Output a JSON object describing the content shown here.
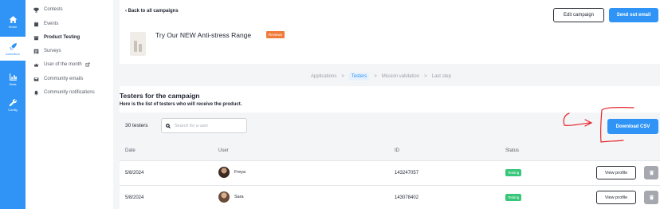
{
  "rail": {
    "items": [
      {
        "label": "Home",
        "icon": "home-icon"
      },
      {
        "label": "Animation",
        "icon": "rocket-icon"
      },
      {
        "label": "Stats",
        "icon": "chart-icon"
      },
      {
        "label": "Config",
        "icon": "wrench-icon"
      }
    ]
  },
  "submenu": {
    "items": [
      {
        "label": "Contests",
        "icon": "trophy-icon"
      },
      {
        "label": "Events",
        "icon": "calendar-icon"
      },
      {
        "label": "Product Testing",
        "icon": "box-icon"
      },
      {
        "label": "Surveys",
        "icon": "survey-icon"
      },
      {
        "label": "User of the month",
        "icon": "crown-icon"
      },
      {
        "label": "Community emails",
        "icon": "mail-icon"
      },
      {
        "label": "Community notifications",
        "icon": "bell-icon"
      }
    ]
  },
  "header": {
    "back_label": "‹ Back to all campaigns",
    "edit_label": "Edit campaign",
    "send_label": "Send out email",
    "campaign_title": "Try Our NEW Anti-stress Range",
    "campaign_badge": "Reviews"
  },
  "steps": {
    "items": [
      "Applications",
      "Testers",
      "Mission validation",
      "Last step"
    ],
    "separator": ">"
  },
  "testers": {
    "title": "Testers for the campaign",
    "subtitle": "Here is the list of testers who will receive the product.",
    "count_label": "30 testers",
    "search_placeholder": "Search for a user",
    "download_label": "Download CSV",
    "columns": {
      "date": "Date",
      "user": "User",
      "id": "ID",
      "status": "Status"
    },
    "rows": [
      {
        "date": "5/8/2024",
        "user": "Freya",
        "id": "143247057",
        "status": "Testing",
        "view_label": "View profile"
      },
      {
        "date": "5/8/2024",
        "user": "Sara",
        "id": "143078402",
        "status": "Testing",
        "view_label": "View profile"
      }
    ]
  },
  "colors": {
    "accent": "#2f94f5",
    "badge_reviews": "#f07b3a",
    "status_testing": "#38c77a",
    "annotation": "#e3262c"
  }
}
